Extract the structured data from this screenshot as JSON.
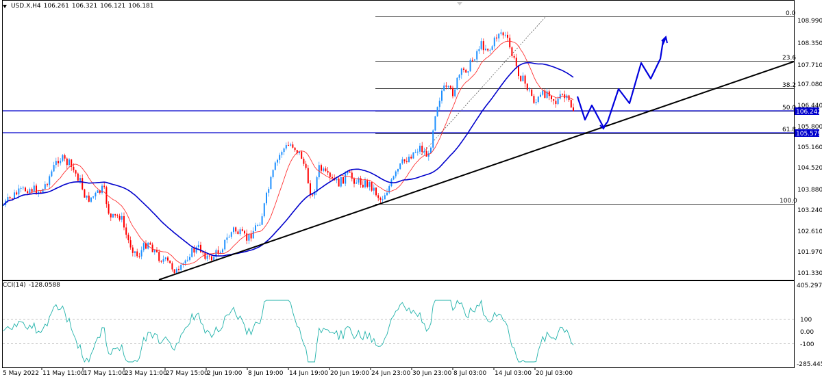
{
  "header": {
    "symbol": "USD.X,H4",
    "open": "106.261",
    "high": "106.321",
    "low": "106.121",
    "close": "106.181"
  },
  "price_axis": {
    "ticks": [
      "108.990",
      "108.350",
      "107.710",
      "107.080",
      "106.440",
      "105.800",
      "105.160",
      "104.520",
      "103.880",
      "103.240",
      "102.610",
      "101.970",
      "101.330"
    ],
    "hline_labels": [
      "106.242",
      "105.579"
    ]
  },
  "fibonacci": {
    "levels": [
      "0.0",
      "23.6",
      "38.2",
      "50.0",
      "61.8",
      "100.0"
    ]
  },
  "cci": {
    "label": "CCI(14)",
    "value": "-128.0588",
    "axis_ticks": [
      "405.2972",
      "100",
      "0.00",
      "-100",
      "-285.4455"
    ]
  },
  "time_axis": {
    "labels": [
      "5 May 2022",
      "11 May 11:00",
      "17 May 11:00",
      "23 May 11:00",
      "27 May 15:00",
      "2 Jun 19:00",
      "8 Jun 19:00",
      "14 Jun 19:00",
      "20 Jun 19:00",
      "24 Jun 23:00",
      "30 Jun 23:00",
      "8 Jul 03:00",
      "14 Jul 03:00",
      "20 Jul 03:00"
    ]
  },
  "colors": {
    "up_candle": "#1e90ff",
    "down_candle": "#ff0000",
    "ma_fast": "#ff3333",
    "ma_slow": "#0000cc",
    "hline": "#0000cc",
    "trendline": "#000000",
    "cci": "#20b2aa",
    "forecast": "#0000dd"
  }
}
